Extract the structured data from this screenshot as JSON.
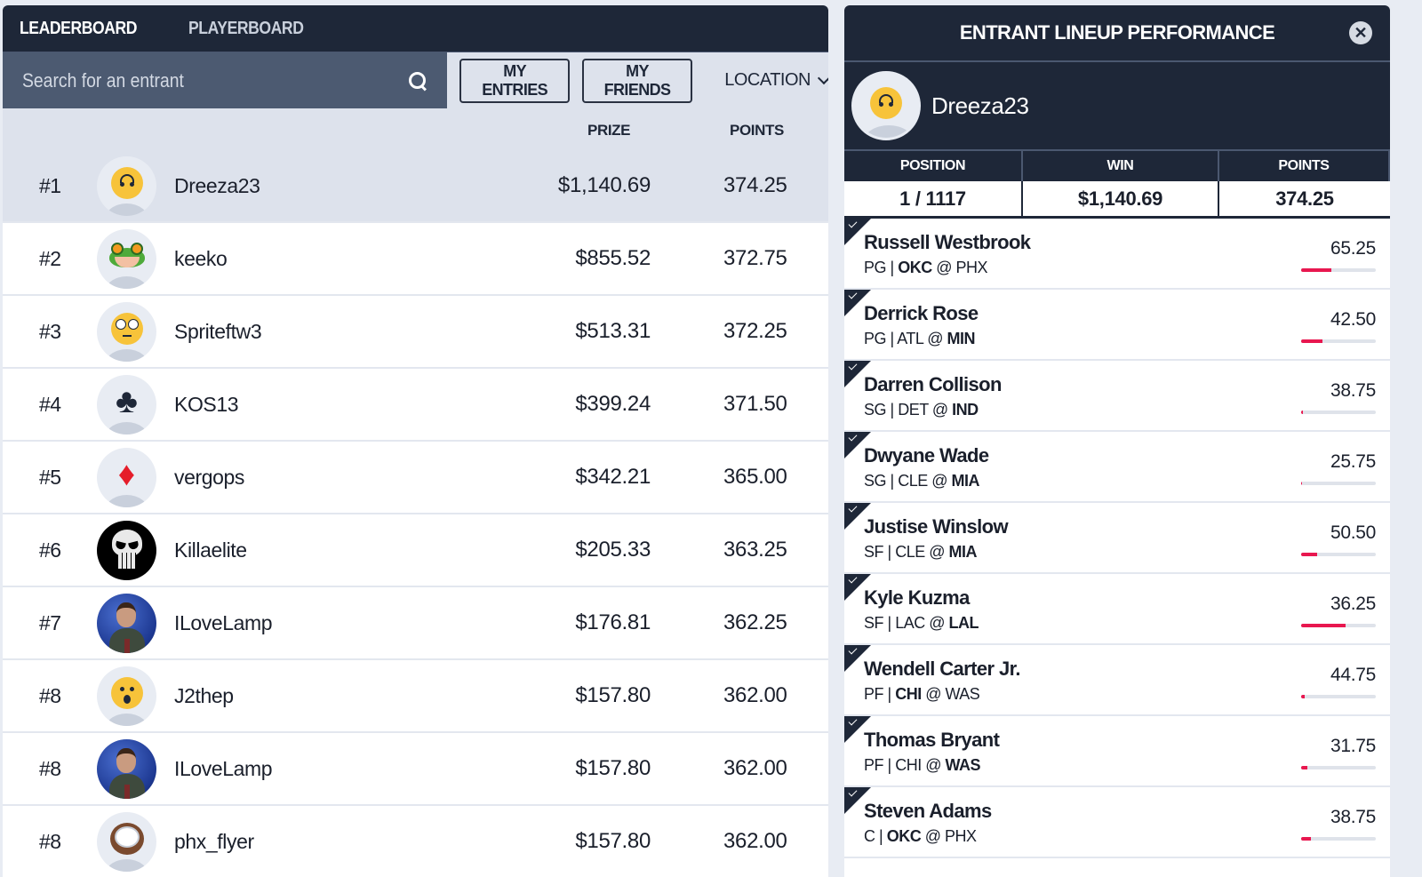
{
  "tabs": [
    {
      "label": "LEADERBOARD",
      "active": true
    },
    {
      "label": "PLAYERBOARD",
      "active": false
    }
  ],
  "search": {
    "placeholder": "Search for an entrant",
    "value": ""
  },
  "filters": {
    "my_entries": "MY ENTRIES",
    "my_friends": "MY FRIENDS",
    "location": "LOCATION"
  },
  "columns": {
    "prize": "PRIZE",
    "points": "POINTS"
  },
  "entrants": [
    {
      "rank": "#1",
      "name": "Dreeza23",
      "prize": "$1,140.69",
      "points": "374.25",
      "avatar": "upside-down-face",
      "selected": true
    },
    {
      "rank": "#2",
      "name": "keeko",
      "prize": "$855.52",
      "points": "372.75",
      "avatar": "frog"
    },
    {
      "rank": "#3",
      "name": "Spriteftw3",
      "prize": "$513.31",
      "points": "372.25",
      "avatar": "eye-roll-face"
    },
    {
      "rank": "#4",
      "name": "KOS13",
      "prize": "$399.24",
      "points": "371.50",
      "avatar": "club-suit"
    },
    {
      "rank": "#5",
      "name": "vergops",
      "prize": "$342.21",
      "points": "365.00",
      "avatar": "diamond-suit"
    },
    {
      "rank": "#6",
      "name": "Killaelite",
      "prize": "$205.33",
      "points": "363.25",
      "avatar": "punisher-skull"
    },
    {
      "rank": "#7",
      "name": "ILoveLamp",
      "prize": "$176.81",
      "points": "362.25",
      "avatar": "photo-man"
    },
    {
      "rank": "#8",
      "name": "J2thep",
      "prize": "$157.80",
      "points": "362.00",
      "avatar": "surprised-face"
    },
    {
      "rank": "#8",
      "name": "ILoveLamp",
      "prize": "$157.80",
      "points": "362.00",
      "avatar": "photo-man"
    },
    {
      "rank": "#8",
      "name": "phx_flyer",
      "prize": "$157.80",
      "points": "362.00",
      "avatar": "coconut"
    }
  ],
  "panel": {
    "title": "ENTRANT LINEUP PERFORMANCE",
    "username": "Dreeza23",
    "stats": {
      "position_label": "POSITION",
      "position": "1 / 1117",
      "win_label": "WIN",
      "win": "$1,140.69",
      "points_label": "POINTS",
      "points": "374.25"
    },
    "players": [
      {
        "name": "Russell Westbrook",
        "pos": "PG",
        "away": "OKC",
        "home": "PHX",
        "bold": "away",
        "points": "65.25",
        "progress": 0.4
      },
      {
        "name": "Derrick Rose",
        "pos": "PG",
        "away": "ATL",
        "home": "MIN",
        "bold": "home",
        "points": "42.50",
        "progress": 0.29
      },
      {
        "name": "Darren Collison",
        "pos": "SG",
        "away": "DET",
        "home": "IND",
        "bold": "home",
        "points": "38.75",
        "progress": 0.02
      },
      {
        "name": "Dwyane Wade",
        "pos": "SG",
        "away": "CLE",
        "home": "MIA",
        "bold": "home",
        "points": "25.75",
        "progress": 0.01
      },
      {
        "name": "Justise Winslow",
        "pos": "SF",
        "away": "CLE",
        "home": "MIA",
        "bold": "home",
        "points": "50.50",
        "progress": 0.21
      },
      {
        "name": "Kyle Kuzma",
        "pos": "SF",
        "away": "LAC",
        "home": "LAL",
        "bold": "home",
        "points": "36.25",
        "progress": 0.6
      },
      {
        "name": "Wendell Carter Jr.",
        "pos": "PF",
        "away": "CHI",
        "home": "WAS",
        "bold": "away",
        "points": "44.75",
        "progress": 0.05
      },
      {
        "name": "Thomas Bryant",
        "pos": "PF",
        "away": "CHI",
        "home": "WAS",
        "bold": "home",
        "points": "31.75",
        "progress": 0.08
      },
      {
        "name": "Steven Adams",
        "pos": "C",
        "away": "OKC",
        "home": "PHX",
        "bold": "away",
        "points": "38.75",
        "progress": 0.13
      }
    ]
  },
  "colors": {
    "accent": "#e8174f",
    "navy": "#1e2738",
    "slate": "#4c5a71"
  }
}
